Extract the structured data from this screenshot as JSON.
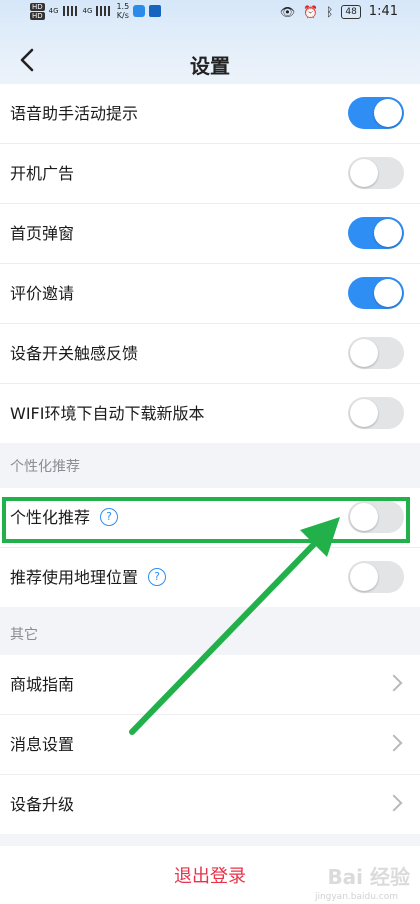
{
  "status_bar": {
    "sim1": "HD",
    "sim2": "HD",
    "net1": "4G",
    "net2": "4G",
    "speed_value": "1.5",
    "speed_unit": "K/s",
    "battery": "48",
    "time": "1:41"
  },
  "header": {
    "title": "设置"
  },
  "settings": [
    {
      "label": "语音助手活动提示",
      "on": true
    },
    {
      "label": "开机广告",
      "on": false
    },
    {
      "label": "首页弹窗",
      "on": true
    },
    {
      "label": "评价邀请",
      "on": true
    },
    {
      "label": "设备开关触感反馈",
      "on": false
    },
    {
      "label": "WIFI环境下自动下载新版本",
      "on": false
    }
  ],
  "personal_section": {
    "title": "个性化推荐",
    "items": [
      {
        "label": "个性化推荐",
        "on": false,
        "help": "?"
      },
      {
        "label": "推荐使用地理位置",
        "on": false,
        "help": "?"
      }
    ]
  },
  "other_section": {
    "title": "其它",
    "items": [
      {
        "label": "商城指南"
      },
      {
        "label": "消息设置"
      },
      {
        "label": "设备升级"
      }
    ]
  },
  "logout": {
    "label": "退出登录"
  },
  "watermark": {
    "text": "Bai 经验",
    "sub": "jingyan.baidu.com"
  },
  "colors": {
    "accent": "#2f8ef4",
    "highlight": "#21b04a",
    "logout": "#e8334a"
  }
}
